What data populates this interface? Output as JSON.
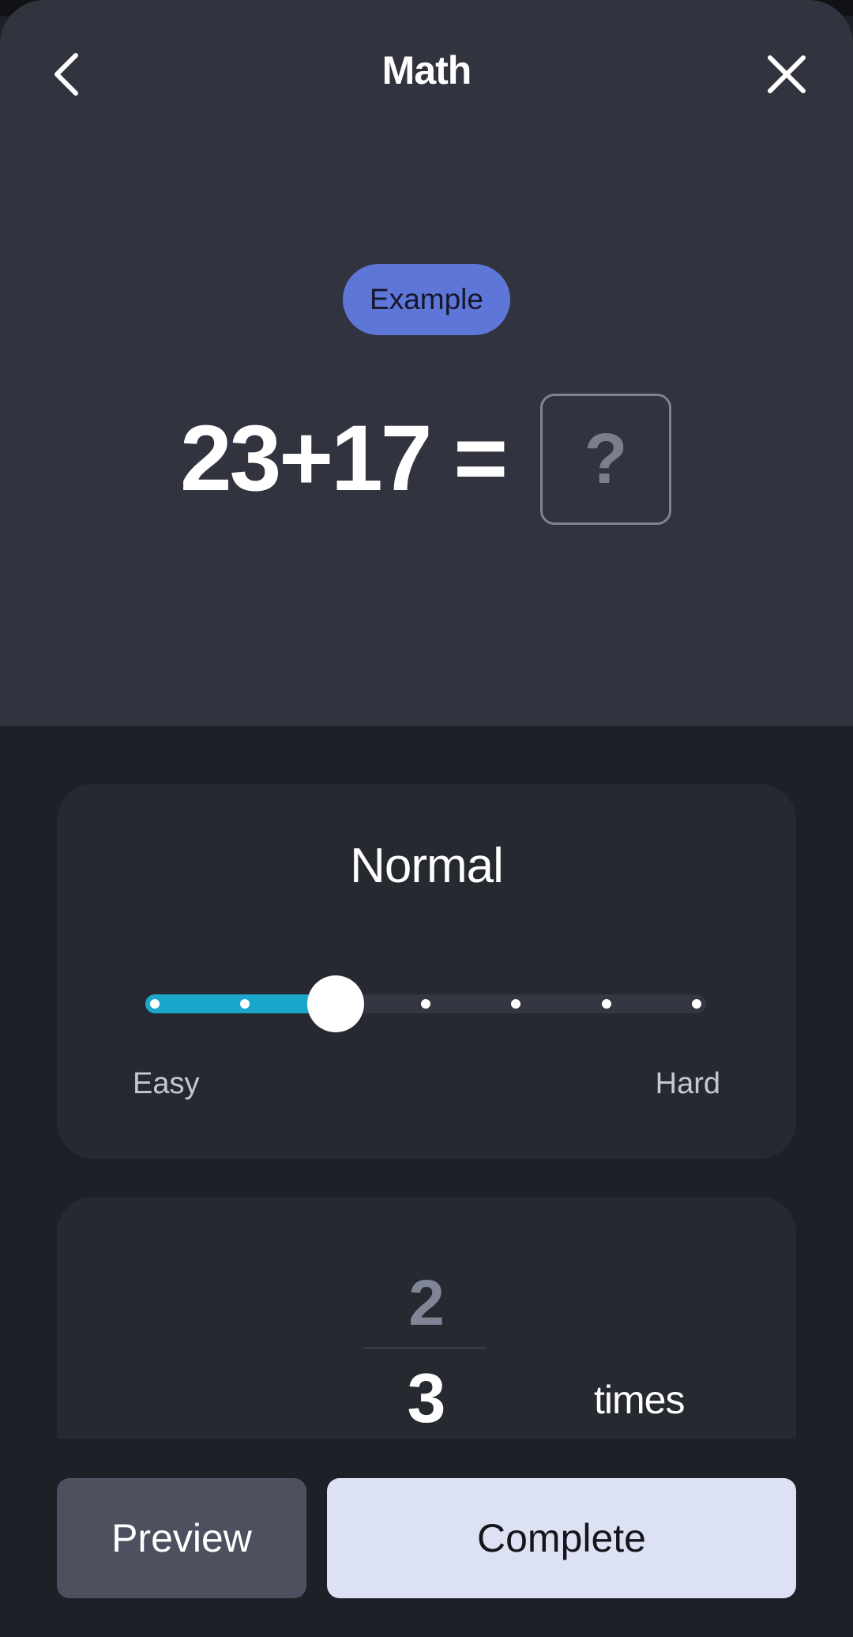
{
  "header": {
    "title": "Math",
    "back_icon": "chevron-left-icon",
    "close_icon": "close-icon"
  },
  "example": {
    "badge_label": "Example",
    "expression": "23+17 =",
    "answer_placeholder": "?"
  },
  "difficulty": {
    "level_label": "Normal",
    "min_label": "Easy",
    "max_label": "Hard",
    "steps": 7,
    "selected_step": 3,
    "accent_color": "#1ba7cb"
  },
  "repeat": {
    "previous_value": "2",
    "current_value": "3",
    "unit_label": "times"
  },
  "actions": {
    "preview_label": "Preview",
    "complete_label": "Complete"
  },
  "colors": {
    "hero_background": "#31333e",
    "badge": "#5e76d8",
    "complete_button": "#dce2f3",
    "preview_button": "#4c505f"
  }
}
